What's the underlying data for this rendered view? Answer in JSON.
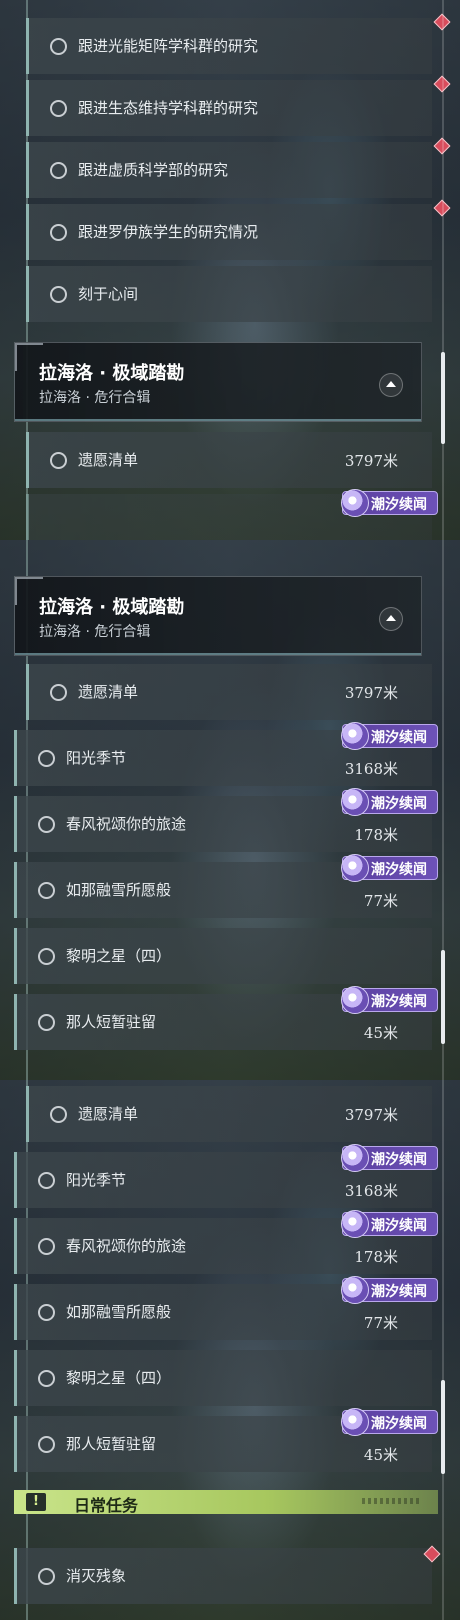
{
  "badge_text": "潮汐续闻",
  "colors": {
    "accent_teal": "#8fb4b0",
    "badge_purple": "#6d52b8",
    "track_diamond": "#d84c5c",
    "daily_green": "#b8d874"
  },
  "section": {
    "title": "拉海洛 · 极域踏勘",
    "subtitle": "拉海洛 · 危行合辑"
  },
  "panel1": {
    "quests": [
      {
        "label": "跟进光能矩阵学科群的研究"
      },
      {
        "label": "跟进生态维持学科群的研究"
      },
      {
        "label": "跟进虚质科学部的研究"
      },
      {
        "label": "跟进罗伊族学生的研究情况"
      },
      {
        "label": "刻于心间"
      }
    ],
    "after_header": [
      {
        "label": "遗愿清单",
        "distance": "3797米"
      }
    ]
  },
  "panel2": {
    "quests": [
      {
        "label": "遗愿清单",
        "distance": "3797米"
      },
      {
        "label": "阳光季节",
        "distance": "3168米"
      },
      {
        "label": "春风祝颂你的旅途",
        "distance": "178米"
      },
      {
        "label": "如那融雪所愿般",
        "distance": "77米"
      },
      {
        "label": "黎明之星（四）",
        "distance": ""
      },
      {
        "label": "那人短暂驻留",
        "distance": "45米"
      }
    ]
  },
  "panel3": {
    "quests": [
      {
        "label": "遗愿清单",
        "distance": "3797米"
      },
      {
        "label": "阳光季节",
        "distance": "3168米"
      },
      {
        "label": "春风祝颂你的旅途",
        "distance": "178米"
      },
      {
        "label": "如那融雪所愿般",
        "distance": "77米"
      },
      {
        "label": "黎明之星（四）",
        "distance": ""
      },
      {
        "label": "那人短暂驻留",
        "distance": "45米"
      }
    ],
    "daily": {
      "icon": "!",
      "title": "日常任务",
      "quests": [
        {
          "label": "消灭残象"
        }
      ]
    }
  },
  "icons": {
    "radio": "circle-outline-icon",
    "track": "diamond-marker-icon",
    "badge": "moon-icon",
    "collapse": "triangle-up-icon",
    "daily": "exclamation-icon"
  }
}
